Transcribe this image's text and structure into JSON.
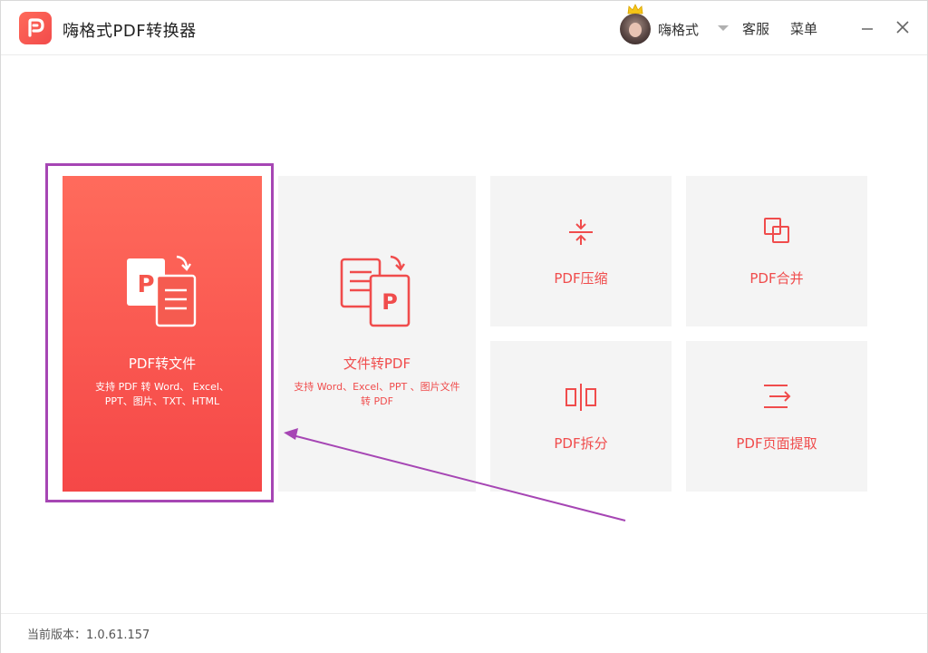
{
  "app": {
    "title": "嗨格式PDF转换器"
  },
  "header": {
    "username": "嗨格式",
    "service_label": "客服",
    "menu_label": "菜单"
  },
  "tiles": [
    {
      "label": "PDF转文件",
      "description": "支持 PDF 转 Word、 Excel、PPT、图片、TXT、HTML",
      "icon": "pdf-to-file-icon"
    },
    {
      "label": "文件转PDF",
      "description": "支持 Word、Excel、PPT 、图片文件转 PDF",
      "icon": "file-to-pdf-icon"
    },
    {
      "label": "PDF压缩",
      "icon": "compress-icon"
    },
    {
      "label": "PDF合并",
      "icon": "merge-icon"
    },
    {
      "label": "PDF拆分",
      "icon": "split-icon"
    },
    {
      "label": "PDF页面提取",
      "icon": "extract-icon"
    }
  ],
  "footer": {
    "version": "当前版本：1.0.61.157"
  },
  "colors": {
    "accent": "#f04c4c",
    "tile_bg": "#f4f4f4",
    "annotation": "#a646b4"
  }
}
